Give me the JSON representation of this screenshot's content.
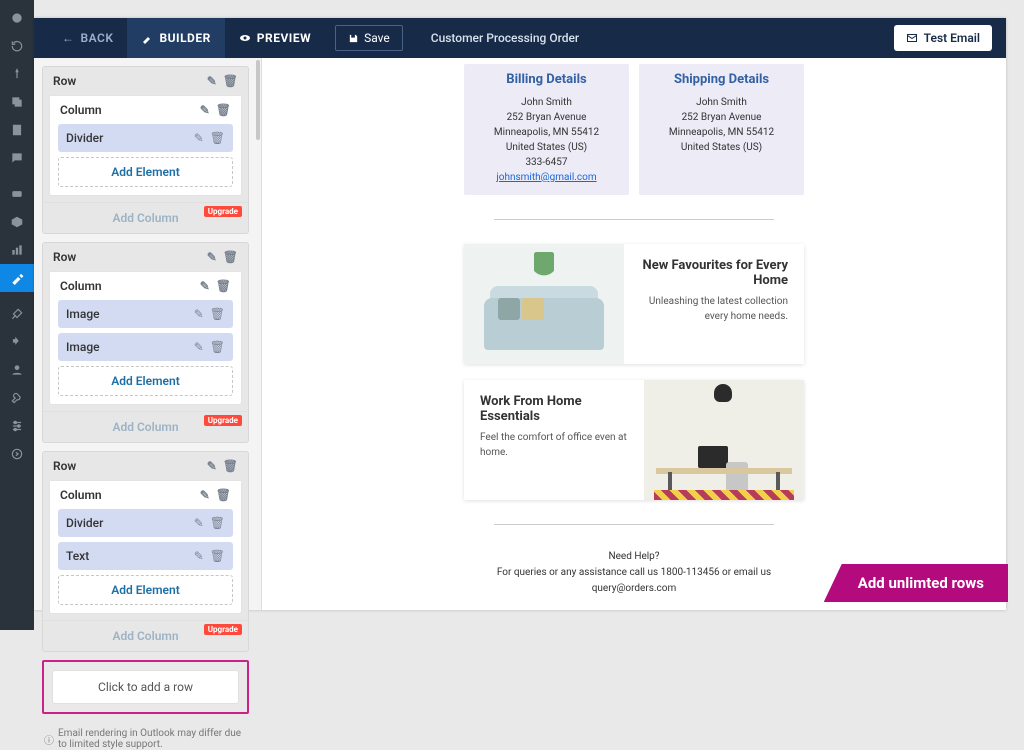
{
  "topbar": {
    "back": "BACK",
    "builder": "BUILDER",
    "preview": "PREVIEW",
    "save": "Save",
    "title": "Customer Processing Order",
    "test": "Test Email"
  },
  "panel": {
    "rows": [
      {
        "label": "Row",
        "column_label": "Column",
        "elements": [
          "Divider"
        ],
        "add_element": "Add Element",
        "add_column": "Add Column",
        "upgrade": "Upgrade"
      },
      {
        "label": "Row",
        "column_label": "Column",
        "elements": [
          "Image",
          "Image"
        ],
        "add_element": "Add Element",
        "add_column": "Add Column",
        "upgrade": "Upgrade"
      },
      {
        "label": "Row",
        "column_label": "Column",
        "elements": [
          "Divider",
          "Text"
        ],
        "add_element": "Add Element",
        "add_column": "Add Column",
        "upgrade": "Upgrade"
      }
    ],
    "add_row": "Click to add a row",
    "footer_note": "Email rendering in Outlook may differ due to limited style support."
  },
  "preview": {
    "billing": {
      "title": "Billing Details",
      "name": "John Smith",
      "street": "252 Bryan Avenue",
      "city": "Minneapolis, MN 55412",
      "country": "United States (US)",
      "phone": "333-6457",
      "email": "johnsmith@gmail.com"
    },
    "shipping": {
      "title": "Shipping Details",
      "name": "John Smith",
      "street": "252 Bryan Avenue",
      "city": "Minneapolis, MN 55412",
      "country": "United States (US)"
    },
    "promo1": {
      "title": "New Favourites for Every Home",
      "desc": "Unleashing the latest collection every home needs."
    },
    "promo2": {
      "title": "Work From Home Essentials",
      "desc": "Feel the comfort of office even at home."
    },
    "help": {
      "l1": "Need Help?",
      "l2": "For queries or any assistance call us 1800-113456 or email us query@orders.com"
    }
  },
  "cta": "Add unlimted rows"
}
